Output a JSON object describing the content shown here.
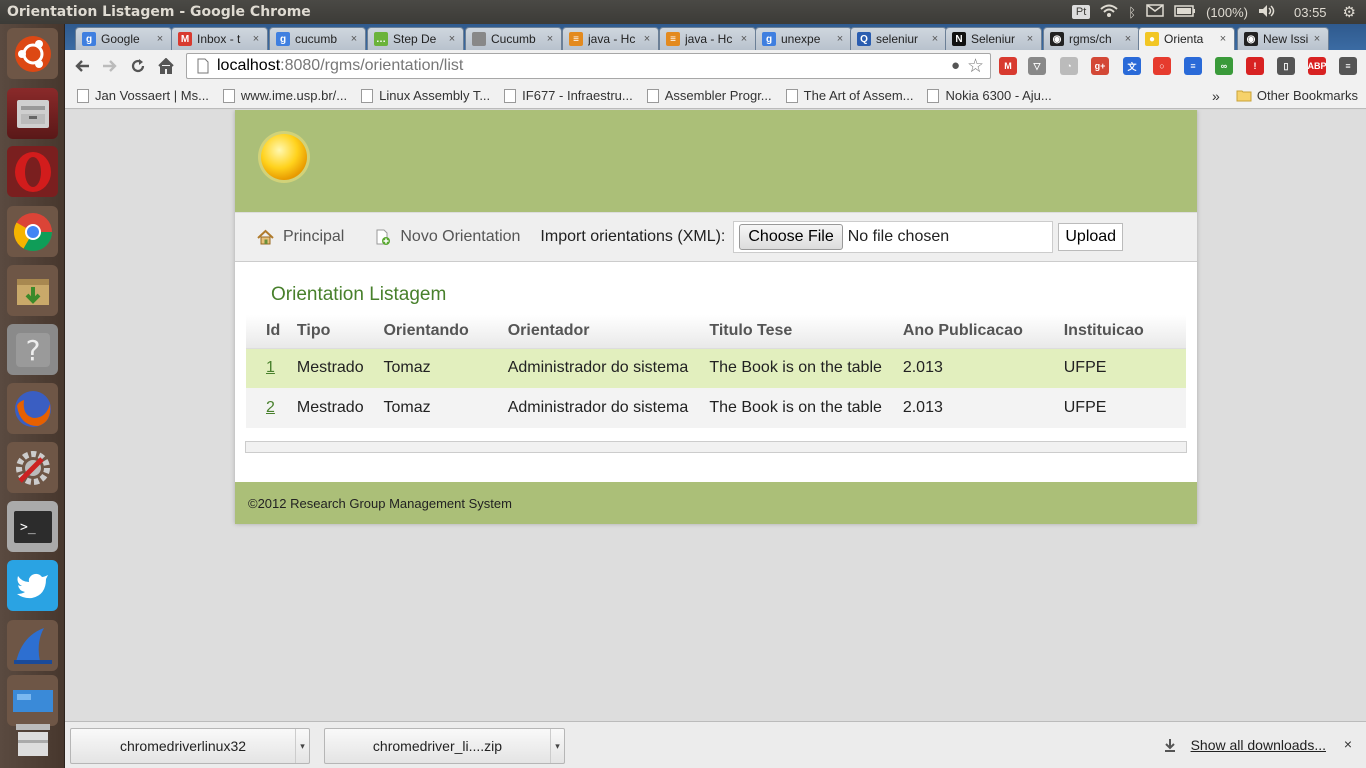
{
  "system": {
    "window_title": "Orientation Listagem - Google Chrome",
    "keyboard_layout": "Pt",
    "battery": "(100%)",
    "clock": "03:55"
  },
  "launcher": [
    "ubuntu-dash",
    "files",
    "opera",
    "chrome",
    "archive-manager",
    "help",
    "firefox",
    "system-settings",
    "terminal",
    "twitter",
    "wireshark",
    "workspaces",
    "trash"
  ],
  "tabs": [
    {
      "label": "Google",
      "icon": "google-icon",
      "color": "#3f7fe0",
      "glyph": "g"
    },
    {
      "label": "Inbox - t",
      "icon": "gmail-icon",
      "color": "#d83a2f",
      "glyph": "M"
    },
    {
      "label": "cucumb",
      "icon": "google-icon",
      "color": "#3f7fe0",
      "glyph": "g"
    },
    {
      "label": "Step De",
      "icon": "chat-icon",
      "color": "#6bb33a",
      "glyph": "…"
    },
    {
      "label": "Cucumb",
      "icon": "page-icon",
      "color": "#888",
      "glyph": ""
    },
    {
      "label": "java - Hc",
      "icon": "stackoverflow-icon",
      "color": "#e38a1f",
      "glyph": "≡"
    },
    {
      "label": "java - Hc",
      "icon": "stackoverflow-icon",
      "color": "#e38a1f",
      "glyph": "≡"
    },
    {
      "label": "unexpe",
      "icon": "google-icon",
      "color": "#3f7fe0",
      "glyph": "g"
    },
    {
      "label": "seleniur",
      "icon": "quora-icon",
      "color": "#2a5db0",
      "glyph": "Q"
    },
    {
      "label": "Seleniur",
      "icon": "notion-icon",
      "color": "#111",
      "glyph": "N"
    },
    {
      "label": "rgms/ch",
      "icon": "github-icon",
      "color": "#222",
      "glyph": "◉"
    },
    {
      "label": "Orienta",
      "icon": "sun-icon",
      "color": "#f2c624",
      "glyph": "●"
    },
    {
      "label": "New Issi",
      "icon": "github-icon",
      "color": "#222",
      "glyph": "◉"
    }
  ],
  "omnibox": {
    "host": "localhost",
    "path": ":8080/rgms/orientation/list"
  },
  "bookmarks": [
    "Jan Vossaert | Ms...",
    "www.ime.usp.br/...",
    "Linux Assembly T...",
    "IF677 - Infraestru...",
    "Assembler Progr...",
    "The Art of Assem...",
    "Nokia 6300 - Aju..."
  ],
  "bookmarks_overflow": "»",
  "other_bookmarks": "Other Bookmarks",
  "app": {
    "nav_home": "Principal",
    "nav_new": "Novo Orientation",
    "import_label": "Import orientations (XML):",
    "choose_file": "Choose File",
    "file_status": "No file chosen",
    "upload": "Upload",
    "list_title": "Orientation Listagem",
    "columns": [
      "Id",
      "Tipo",
      "Orientando",
      "Orientador",
      "Titulo Tese",
      "Ano Publicacao",
      "Instituicao"
    ],
    "rows": [
      {
        "id": "1",
        "tipo": "Mestrado",
        "orientando": "Tomaz",
        "orientador": "Administrador do sistema",
        "titulo": "The Book is on the table",
        "ano": "2.013",
        "instituicao": "UFPE"
      },
      {
        "id": "2",
        "tipo": "Mestrado",
        "orientando": "Tomaz",
        "orientador": "Administrador do sistema",
        "titulo": "The Book is on the table",
        "ano": "2.013",
        "instituicao": "UFPE"
      }
    ],
    "footer": "©2012 Research Group Management System"
  },
  "downloads": {
    "items": [
      "chromedriverlinux32",
      "chromedriver_li....zip"
    ],
    "show_all": "Show all downloads...",
    "close": "×"
  }
}
